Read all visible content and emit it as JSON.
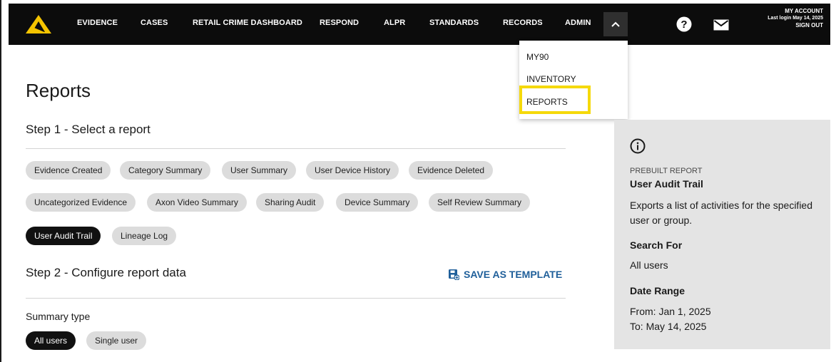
{
  "nav": {
    "items": [
      "EVIDENCE",
      "CASES",
      "RETAIL CRIME DASHBOARD",
      "RESPOND",
      "ALPR",
      "STANDARDS",
      "RECORDS",
      "ADMIN"
    ],
    "account_title": "MY ACCOUNT",
    "last_login": "Last login May 14, 2025",
    "sign_out": "SIGN OUT",
    "logo_color": "#f5c400"
  },
  "dropdown": {
    "items": [
      "MY90",
      "INVENTORY",
      "REPORTS"
    ],
    "highlighted": "REPORTS",
    "highlight_color": "#f5d90a"
  },
  "page": {
    "title": "Reports",
    "step1": "Step 1 - Select a report",
    "step2": "Step 2 - Configure report data",
    "save_template": "SAVE AS TEMPLATE",
    "summary_type_label": "Summary type"
  },
  "reports": [
    "Evidence Created",
    "Category Summary",
    "User Summary",
    "User Device History",
    "Evidence Deleted",
    "Uncategorized Evidence",
    "Axon Video Summary",
    "Sharing Audit",
    "Device Summary",
    "Self Review Summary",
    "User Audit Trail",
    "Lineage Log"
  ],
  "selected_report": "User Audit Trail",
  "summary_types": [
    "All users",
    "Single user"
  ],
  "selected_summary_type": "All users",
  "panel": {
    "kicker": "PREBUILT REPORT",
    "name": "User Audit Trail",
    "description": "Exports a list of activities for the specified user or group.",
    "search_for_label": "Search For",
    "search_for_value": "All users",
    "date_range_label": "Date Range",
    "date_from": "From: Jan 1, 2025",
    "date_to": "To: May 14, 2025"
  },
  "colors": {
    "accent_link": "#1f5f9a",
    "chip": "#dcdcdc",
    "chip_selected": "#111111",
    "panel_bg": "#e4e4e4",
    "topbar": "#0c0c0c"
  }
}
